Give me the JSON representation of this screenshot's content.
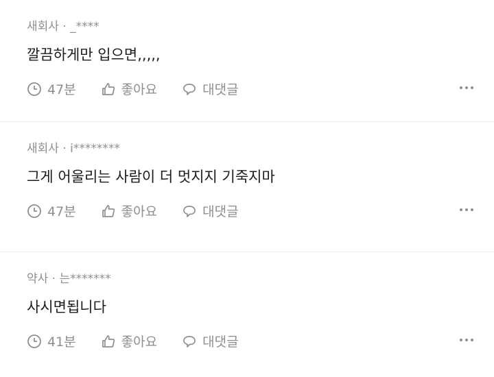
{
  "comments": [
    {
      "author": "새회사 · _****",
      "text": "깔끔하게만 입으면,,,,,",
      "time": "47분",
      "like_label": "좋아요",
      "reply_label": "대댓글"
    },
    {
      "author": "새회사 · i********",
      "text": "그게 어울리는 사람이 더 멋지지 기죽지마",
      "time": "47분",
      "like_label": "좋아요",
      "reply_label": "대댓글"
    },
    {
      "author": "약사 · 는*******",
      "text": "사시면됩니다",
      "time": "41분",
      "like_label": "좋아요",
      "reply_label": "대댓글"
    }
  ],
  "icons": {
    "time": "clock-icon",
    "like": "thumbs-up-icon",
    "reply": "speech-bubble-icon",
    "more": "more-dots-icon"
  },
  "colors": {
    "text": "#1b1b1b",
    "muted": "#8e8e8e",
    "divider": "#ececec"
  }
}
